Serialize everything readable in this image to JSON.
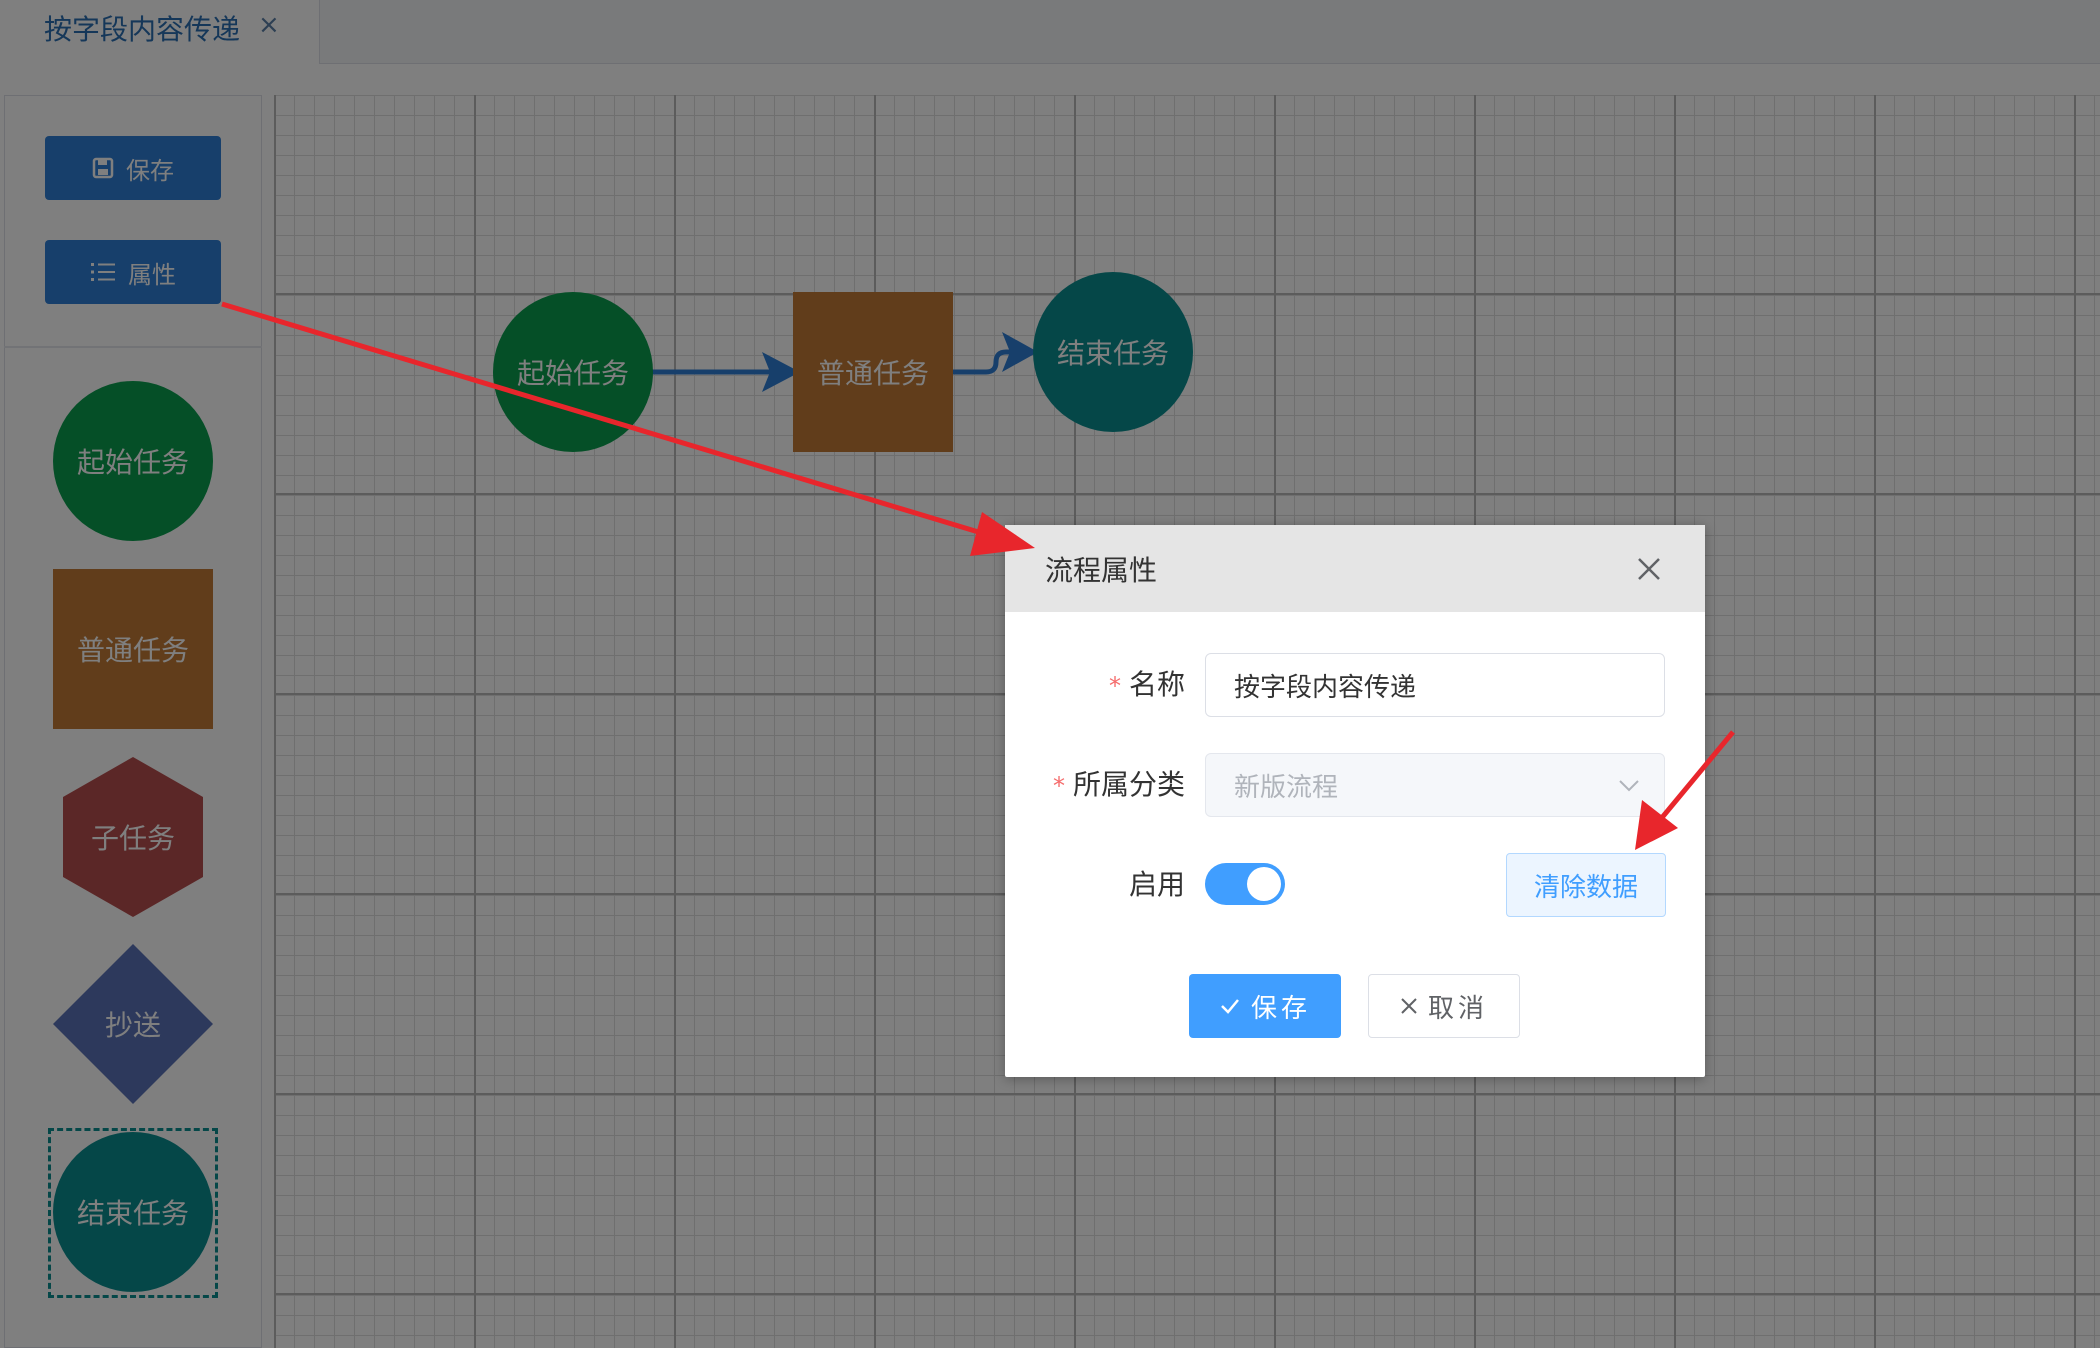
{
  "tab": {
    "label": "按字段内容传递",
    "close": "×"
  },
  "toolbar": {
    "save_label": "保存",
    "props_label": "属性"
  },
  "palette": {
    "start": {
      "label": "起始任务",
      "color": "#0a9e4f"
    },
    "normal": {
      "label": "普通任务",
      "color": "#c37a36"
    },
    "sub": {
      "label": "子任务",
      "color": "#b74f4f"
    },
    "cc": {
      "label": "抄送",
      "color": "#5a73b8"
    },
    "end": {
      "label": "结束任务",
      "color": "#0b8f91"
    }
  },
  "flow": {
    "nodes": [
      {
        "label": "起始任务"
      },
      {
        "label": "普通任务"
      },
      {
        "label": "结束任务"
      }
    ],
    "edge_color": "#2f7fd6"
  },
  "dialog": {
    "title": "流程属性",
    "name_label": "名称",
    "name_value": "按字段内容传递",
    "category_label": "所属分类",
    "category_value": "新版流程",
    "enable_label": "启用",
    "enabled": true,
    "clear_label": "清除数据",
    "save_label": "保存",
    "cancel_label": "取消",
    "required_mark": "*"
  },
  "colors": {
    "primary": "#409eff",
    "toolbar_blue": "#2f7fd6",
    "annotation_red": "#e8262c"
  }
}
